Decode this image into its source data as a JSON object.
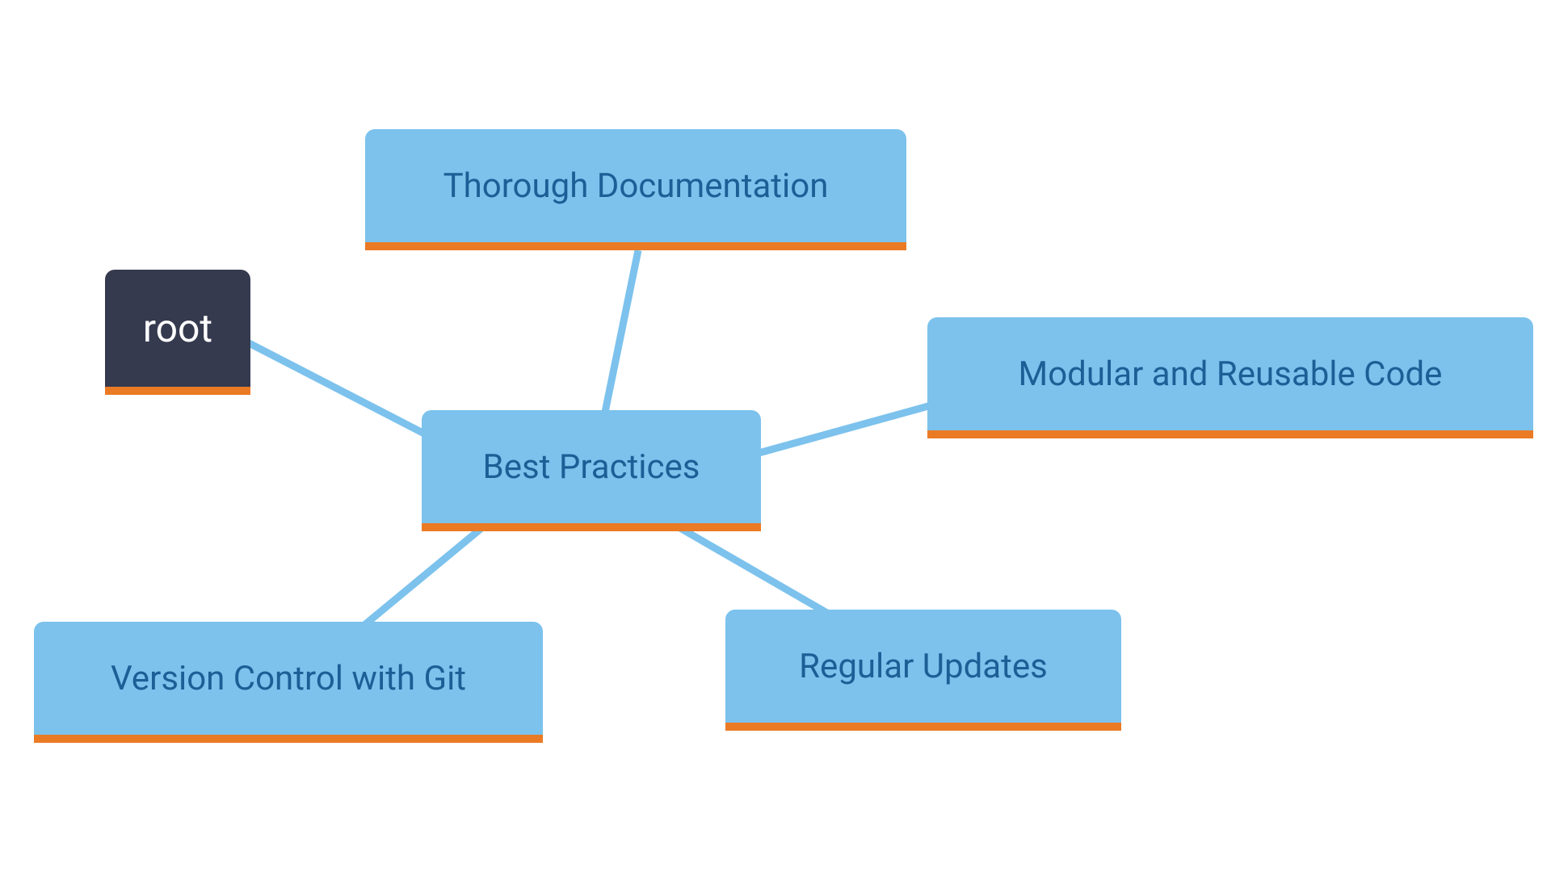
{
  "diagram": {
    "nodes": {
      "root": {
        "label": "root"
      },
      "center": {
        "label": "Best Practices"
      },
      "top": {
        "label": "Thorough Documentation"
      },
      "right": {
        "label": "Modular and Reusable Code"
      },
      "bottom_right": {
        "label": "Regular Updates"
      },
      "bottom_left": {
        "label": "Version Control with Git"
      }
    },
    "edges": [
      {
        "from": "root",
        "to": "center"
      },
      {
        "from": "center",
        "to": "top"
      },
      {
        "from": "center",
        "to": "right"
      },
      {
        "from": "center",
        "to": "bottom_right"
      },
      {
        "from": "center",
        "to": "bottom_left"
      }
    ]
  }
}
